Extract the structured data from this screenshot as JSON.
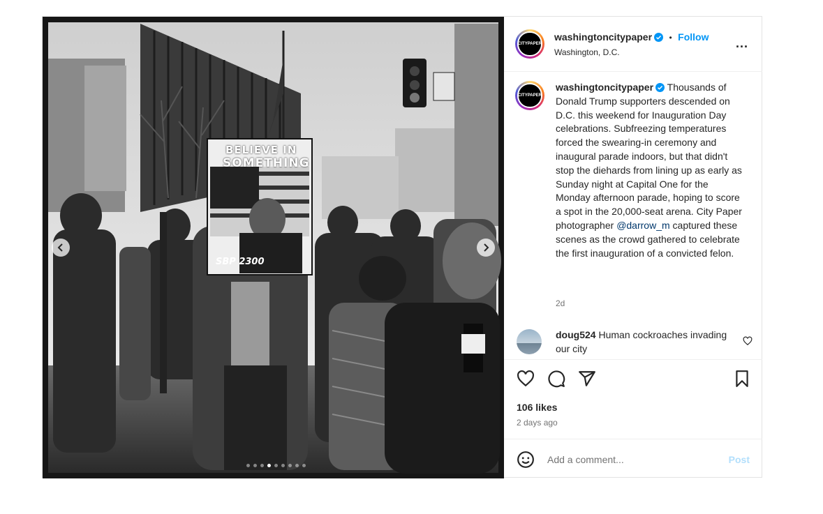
{
  "post": {
    "media": {
      "sign_line1": "BELIEVE IN",
      "sign_line2": "SOMETHING",
      "sign_footer": "SBP 2300",
      "prev_icon": "chevron-left-icon",
      "next_icon": "chevron-right-icon",
      "slide_count": 9,
      "active_slide": 4
    },
    "header": {
      "avatar_text": "CITYPAPER",
      "username": "washingtoncitypaper",
      "separator": "•",
      "follow_label": "Follow",
      "location": "Washington, D.C.",
      "more_label": "..."
    },
    "caption": {
      "username": "washingtoncitypaper",
      "text_before": "Thousands of Donald Trump supporters descended on D.C. this weekend for Inauguration Day celebrations. Subfreezing temperatures forced the swearing-in ceremony and inaugural parade indoors, but that didn't stop the diehards from lining up as early as Sunday night at Capital One for the Monday afternoon parade, hoping to score a spot in the 20,000-seat arena. City Paper photographer ",
      "mention": "@darrow_m",
      "text_after": " captured these scenes as the crowd gathered to celebrate the first inauguration of a convicted felon.",
      "time": "2d"
    },
    "comment": {
      "username": "doug524",
      "text": "Human cockroaches invading our city"
    },
    "actions": {
      "like_icon": "heart-icon",
      "comment_icon": "comment-icon",
      "share_icon": "share-icon",
      "save_icon": "bookmark-icon",
      "likes": "106 likes",
      "posted": "2 days ago"
    },
    "add_comment": {
      "emoji_icon": "emoji-icon",
      "placeholder": "Add a comment...",
      "post_label": "Post"
    },
    "colors": {
      "link_blue": "#0095f6",
      "post_disabled": "#b2dffc",
      "mention": "#00376b",
      "secondary_text": "#737373"
    }
  }
}
